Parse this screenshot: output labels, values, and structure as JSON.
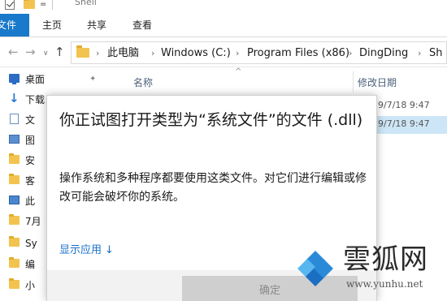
{
  "window": {
    "title": "Shell"
  },
  "quick_access": {
    "dropdown_glyph": "="
  },
  "ribbon": {
    "tabs": [
      {
        "label": "文件",
        "active": true
      },
      {
        "label": "主页"
      },
      {
        "label": "共享"
      },
      {
        "label": "查看"
      }
    ]
  },
  "nav": {
    "back_glyph": "←",
    "forward_glyph": "→",
    "recent_glyph": "∨",
    "up_glyph": "↑",
    "separator_glyph": "›",
    "breadcrumb": [
      "此电脑",
      "Windows (C:)",
      "Program Files (x86)",
      "DingDing",
      "Sh"
    ]
  },
  "sidebar": {
    "pin_glyph": "✦",
    "items": [
      {
        "label": "桌面",
        "icon": "desktop-icon"
      },
      {
        "label": "下载",
        "icon": "download-icon"
      },
      {
        "label": "文",
        "icon": "document-icon"
      },
      {
        "label": "图",
        "icon": "picture-icon"
      },
      {
        "label": "安",
        "icon": "folder-icon"
      },
      {
        "label": "客",
        "icon": "folder-icon"
      },
      {
        "label": "此",
        "icon": "computer-icon"
      },
      {
        "label": "7月",
        "icon": "folder-icon"
      },
      {
        "label": "Sy",
        "icon": "folder-icon"
      },
      {
        "label": "编",
        "icon": "folder-icon"
      },
      {
        "label": "小",
        "icon": "folder-icon"
      }
    ]
  },
  "file_list": {
    "columns": {
      "name": "名称",
      "date": "修改日期"
    },
    "sort_glyph": "^",
    "rows": [
      {
        "date": "9/7/18 9:47"
      },
      {
        "date": "9/7/18 9:47",
        "selected": true
      }
    ]
  },
  "dialog": {
    "title": "你正试图打开类型为“系统文件”的文件 (.dll)",
    "body": "操作系统和多种程序都要使用这类文件。对它们进行编辑或修改可能会破坏你的系统。",
    "link_label": "显示应用",
    "link_arrow": "↓",
    "ok_label": "确定"
  },
  "watermark": {
    "brand": "雲狐网",
    "url": "www.yunhu.net"
  },
  "colors": {
    "accent": "#1979ca",
    "link": "#1a6fc7",
    "selection": "#cde6f7",
    "button_disabled": "#cfcfcf"
  }
}
